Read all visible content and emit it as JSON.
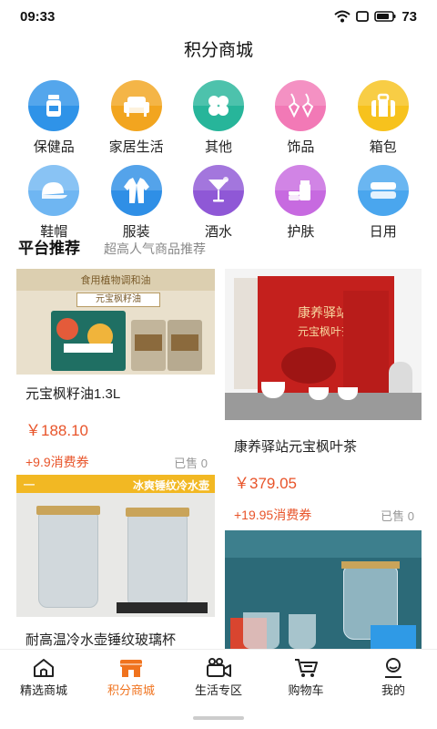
{
  "status": {
    "time": "09:33",
    "battery": "73"
  },
  "header": {
    "title": "积分商城"
  },
  "categories": [
    {
      "label": "保健品",
      "icon": "pill-bottle-icon",
      "color": "#2f93e8"
    },
    {
      "label": "家居生活",
      "icon": "sofa-icon",
      "color": "#f2a51f"
    },
    {
      "label": "其他",
      "icon": "clover-icon",
      "color": "#27b59a"
    },
    {
      "label": "饰品",
      "icon": "earrings-icon",
      "color": "#f279b6"
    },
    {
      "label": "箱包",
      "icon": "suitcase-icon",
      "color": "#f7c21d"
    },
    {
      "label": "鞋帽",
      "icon": "cap-icon",
      "color": "#6fb6f2"
    },
    {
      "label": "服装",
      "icon": "suit-icon",
      "color": "#2f8fe6"
    },
    {
      "label": "酒水",
      "icon": "cocktail-icon",
      "color": "#8f58d6"
    },
    {
      "label": "护肤",
      "icon": "skincare-icon",
      "color": "#c76ae0"
    },
    {
      "label": "日用",
      "icon": "towel-icon",
      "color": "#4aa6ee"
    }
  ],
  "section": {
    "title": "平台推荐",
    "subtitle": "超高人气商品推荐"
  },
  "products": [
    {
      "name": "元宝枫籽油1.3L",
      "price": "￥188.10",
      "coupon": "+9.9消费券",
      "sold": "已售 0",
      "image_text": "食用植物调和油",
      "image_subtext": "元宝枫籽油"
    },
    {
      "name": "康养驿站元宝枫叶茶",
      "price": "￥379.05",
      "coupon": "+19.95消费券",
      "sold": "已售 0",
      "image_text": "康养驿站",
      "image_subtext": "元宝枫叶茶"
    },
    {
      "name": "耐高温冷水壶锤纹玻璃杯",
      "image_text": "冰爽锤纹冷水壶"
    },
    {
      "name": ""
    }
  ],
  "tabs": [
    {
      "label": "精选商城",
      "icon": "home-icon",
      "active": false
    },
    {
      "label": "积分商城",
      "icon": "store-icon",
      "active": true
    },
    {
      "label": "生活专区",
      "icon": "video-camera-icon",
      "active": false
    },
    {
      "label": "购物车",
      "icon": "cart-icon",
      "active": false
    },
    {
      "label": "我的",
      "icon": "profile-icon",
      "active": false
    }
  ],
  "colors": {
    "accent": "#f0731e",
    "price": "#e8542a"
  }
}
